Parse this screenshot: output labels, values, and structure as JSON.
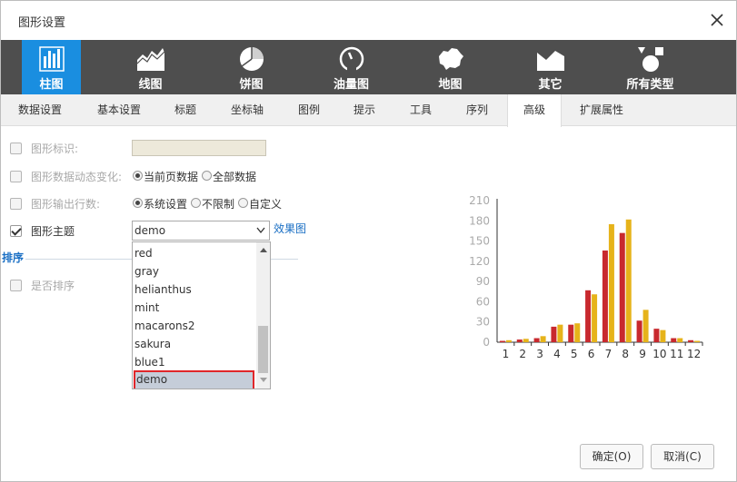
{
  "window": {
    "title": "图形设置",
    "close_icon": "close-icon"
  },
  "chart_types": [
    {
      "label": "柱图",
      "icon": "bar-chart-icon",
      "active": true
    },
    {
      "label": "线图",
      "icon": "line-chart-icon",
      "active": false
    },
    {
      "label": "饼图",
      "icon": "pie-chart-icon",
      "active": false
    },
    {
      "label": "油量图",
      "icon": "gauge-icon",
      "active": false
    },
    {
      "label": "地图",
      "icon": "map-icon",
      "active": false
    },
    {
      "label": "其它",
      "icon": "other-chart-icon",
      "active": false
    },
    {
      "label": "所有类型",
      "icon": "all-types-icon",
      "active": false
    }
  ],
  "tabs": [
    {
      "label": "数据设置"
    },
    {
      "label": "基本设置"
    },
    {
      "label": "标题"
    },
    {
      "label": "坐标轴"
    },
    {
      "label": "图例"
    },
    {
      "label": "提示"
    },
    {
      "label": "工具"
    },
    {
      "label": "序列"
    },
    {
      "label": "高级",
      "active": true
    },
    {
      "label": "扩展属性"
    }
  ],
  "form": {
    "graph_id": {
      "label": "图形标识:",
      "value": "",
      "checked": false
    },
    "dynamic_change": {
      "label": "图形数据动态变化:",
      "checked": false,
      "options": [
        "当前页数据",
        "全部数据"
      ],
      "selected": "当前页数据"
    },
    "output_rows": {
      "label": "图形输出行数:",
      "checked": false,
      "options": [
        "系统设置",
        "不限制",
        "自定义"
      ],
      "selected": "系统设置"
    },
    "theme": {
      "label": "图形主题",
      "checked": true,
      "value": "demo",
      "effect_link": "效果图"
    },
    "sort_section": {
      "title": "排序"
    },
    "is_sort": {
      "label": "是否排序",
      "checked": false
    }
  },
  "theme_dropdown": {
    "options": [
      "red",
      "gray",
      "helianthus",
      "mint",
      "macarons2",
      "sakura",
      "blue1",
      "demo"
    ],
    "selected": "demo"
  },
  "colors": {
    "accent": "#1a8ee0",
    "series1": "#c8292e",
    "series2": "#e6b31a",
    "link": "#1a6fc4"
  },
  "chart_data": {
    "type": "bar",
    "categories": [
      "1",
      "2",
      "3",
      "4",
      "5",
      "6",
      "7",
      "8",
      "9",
      "10",
      "11",
      "12"
    ],
    "series": [
      {
        "values": [
          2,
          4,
          6,
          23,
          26,
          77,
          136,
          162,
          32,
          20,
          6,
          3
        ]
      },
      {
        "values": [
          3,
          5,
          9,
          26,
          28,
          71,
          175,
          182,
          48,
          18,
          6,
          2
        ]
      }
    ],
    "yticks": [
      "0",
      "30",
      "60",
      "90",
      "120",
      "150",
      "180",
      "210"
    ],
    "ylim": [
      0,
      210
    ]
  },
  "buttons": {
    "ok": "确定(O)",
    "cancel": "取消(C)"
  }
}
